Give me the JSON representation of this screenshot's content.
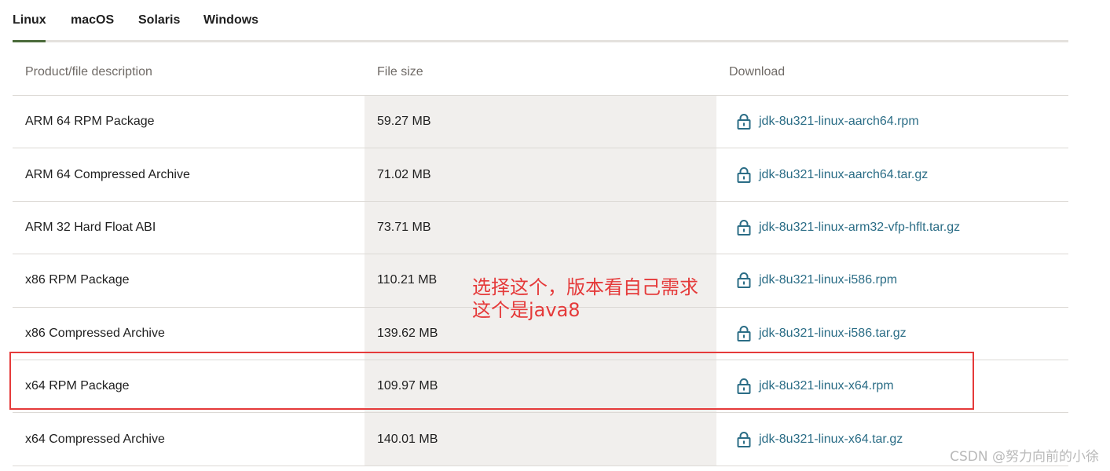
{
  "tabs": [
    {
      "label": "Linux"
    },
    {
      "label": "macOS"
    },
    {
      "label": "Solaris"
    },
    {
      "label": "Windows"
    }
  ],
  "active_tab": "Linux",
  "table": {
    "headers": [
      "Product/file description",
      "File size",
      "Download"
    ],
    "rows": [
      {
        "description": "ARM 64 RPM Package",
        "size": "59.27 MB",
        "file": "jdk-8u321-linux-aarch64.rpm"
      },
      {
        "description": "ARM 64 Compressed Archive",
        "size": "71.02 MB",
        "file": "jdk-8u321-linux-aarch64.tar.gz"
      },
      {
        "description": "ARM 32 Hard Float ABI",
        "size": "73.71 MB",
        "file": "jdk-8u321-linux-arm32-vfp-hflt.tar.gz"
      },
      {
        "description": "x86 RPM Package",
        "size": "110.21 MB",
        "file": "jdk-8u321-linux-i586.rpm"
      },
      {
        "description": "x86 Compressed Archive",
        "size": "139.62 MB",
        "file": "jdk-8u321-linux-i586.tar.gz"
      },
      {
        "description": "x64 RPM Package",
        "size": "109.97 MB",
        "file": "jdk-8u321-linux-x64.rpm"
      },
      {
        "description": "x64 Compressed Archive",
        "size": "140.01 MB",
        "file": "jdk-8u321-linux-x64.tar.gz"
      }
    ]
  },
  "annotation": {
    "line1": "选择这个，版本看自己需求",
    "line2": "这个是java8"
  },
  "watermark": "CSDN @努力向前的小徐",
  "colors": {
    "link": "#2b6d86",
    "annotation": "#e53a3a",
    "active_tab_underline": "#4b6b3a",
    "size_column_bg": "#f1efed"
  },
  "icons": {
    "download": "lock-icon"
  }
}
